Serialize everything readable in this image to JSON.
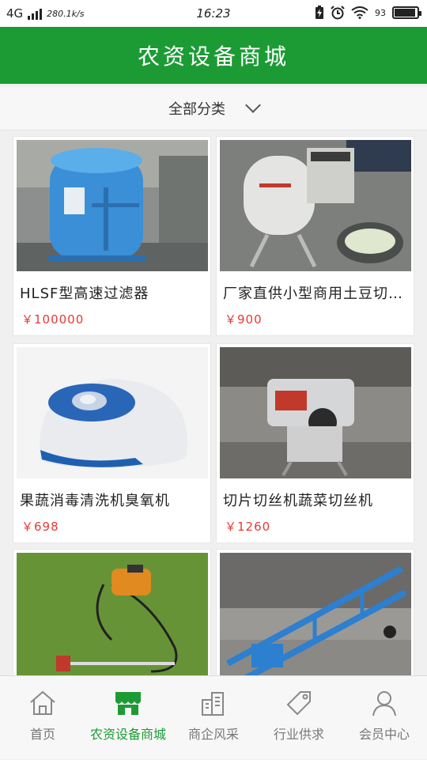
{
  "status_bar": {
    "network": "4G",
    "speed": "280.1k/s",
    "time": "16:23",
    "battery": "93"
  },
  "header": {
    "title": "农资设备商城"
  },
  "filter": {
    "label": "全部分类"
  },
  "products": [
    {
      "name": "HLSF型高速过滤器",
      "price": "￥100000"
    },
    {
      "name": "厂家直供小型商用土豆切丝机",
      "price": "￥900"
    },
    {
      "name": "果蔬消毒清洗机臭氧机",
      "price": "￥698"
    },
    {
      "name": "切片切丝机蔬菜切丝机",
      "price": "￥1260"
    },
    {
      "name": "",
      "price": ""
    },
    {
      "name": "",
      "price": ""
    }
  ],
  "tabs": [
    {
      "label": "首页",
      "icon": "home-icon"
    },
    {
      "label": "农资设备商城",
      "icon": "store-icon"
    },
    {
      "label": "商企风采",
      "icon": "buildings-icon"
    },
    {
      "label": "行业供求",
      "icon": "tag-icon"
    },
    {
      "label": "会员中心",
      "icon": "user-icon"
    }
  ],
  "colors": {
    "brand": "#1c9b35",
    "price": "#e53935"
  }
}
